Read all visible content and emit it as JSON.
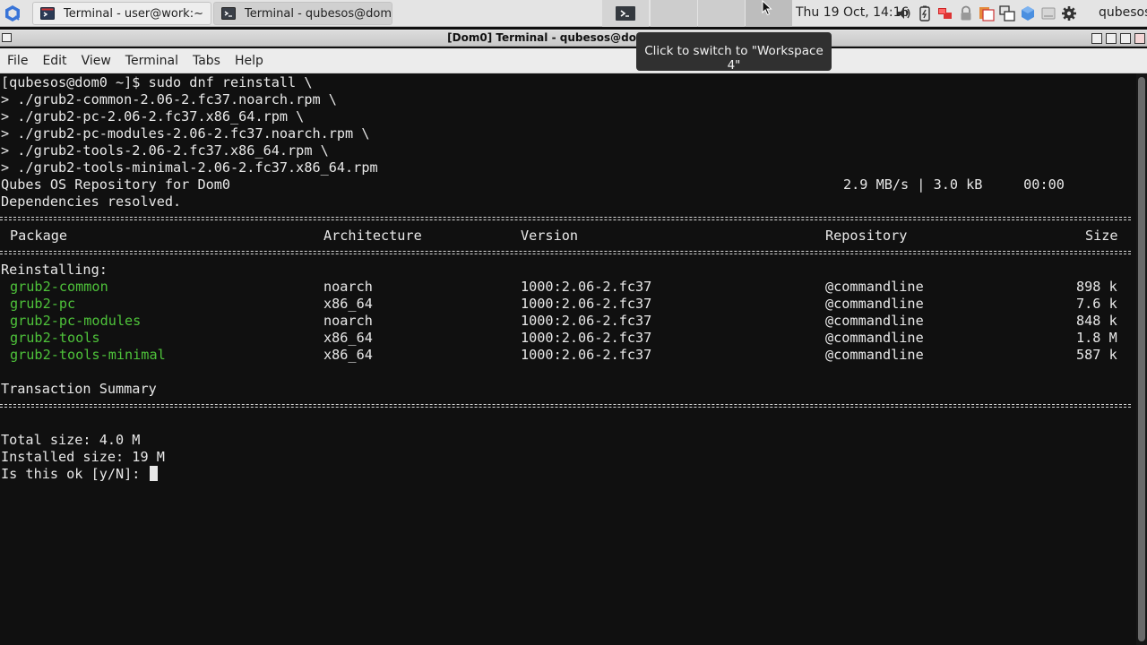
{
  "taskbar": {
    "tasks": [
      {
        "title": "Terminal - user@work:~"
      },
      {
        "title": "Terminal - qubesos@dom..."
      }
    ],
    "clock": "Thu 19 Oct, 14:16",
    "user": "qubesos",
    "tray_icons": [
      "volume-icon",
      "battery-icon",
      "network-icon",
      "lock-icon",
      "clipboard-icon",
      "windows-icon",
      "qube-icon",
      "device-icon",
      "settings-icon"
    ],
    "tooltip": "Click to switch to \"Workspace 4\""
  },
  "window": {
    "title": "[Dom0] Terminal - qubesos@dom0"
  },
  "menubar": {
    "items": [
      "File",
      "Edit",
      "View",
      "Terminal",
      "Tabs",
      "Help"
    ]
  },
  "terminal": {
    "command_lines": [
      "[qubesos@dom0 ~]$ sudo dnf reinstall \\",
      "> ./grub2-common-2.06-2.fc37.noarch.rpm \\",
      "> ./grub2-pc-2.06-2.fc37.x86_64.rpm \\",
      "> ./grub2-pc-modules-2.06-2.fc37.noarch.rpm \\",
      "> ./grub2-tools-2.06-2.fc37.x86_64.rpm \\",
      "> ./grub2-tools-minimal-2.06-2.fc37.x86_64.rpm"
    ],
    "repo_line": "Qubes OS Repository for Dom0",
    "repo_stats": "2.9 MB/s | 3.0 kB     00:00",
    "deps": "Dependencies resolved.",
    "columns": {
      "package": "Package",
      "architecture": "Architecture",
      "version": "Version",
      "repository": "Repository",
      "size": "Size"
    },
    "section": "Reinstalling:",
    "packages": [
      {
        "name": "grub2-common",
        "arch": "noarch",
        "version": "1000:2.06-2.fc37",
        "repo": "@commandline",
        "size": "898 k"
      },
      {
        "name": "grub2-pc",
        "arch": "x86_64",
        "version": "1000:2.06-2.fc37",
        "repo": "@commandline",
        "size": "7.6 k"
      },
      {
        "name": "grub2-pc-modules",
        "arch": "noarch",
        "version": "1000:2.06-2.fc37",
        "repo": "@commandline",
        "size": "848 k"
      },
      {
        "name": "grub2-tools",
        "arch": "x86_64",
        "version": "1000:2.06-2.fc37",
        "repo": "@commandline",
        "size": "1.8 M"
      },
      {
        "name": "grub2-tools-minimal",
        "arch": "x86_64",
        "version": "1000:2.06-2.fc37",
        "repo": "@commandline",
        "size": "587 k"
      }
    ],
    "summary_title": "Transaction Summary",
    "total_size": "Total size: 4.0 M",
    "installed_size": "Installed size: 19 M",
    "prompt": "Is this ok [y/N]: "
  }
}
